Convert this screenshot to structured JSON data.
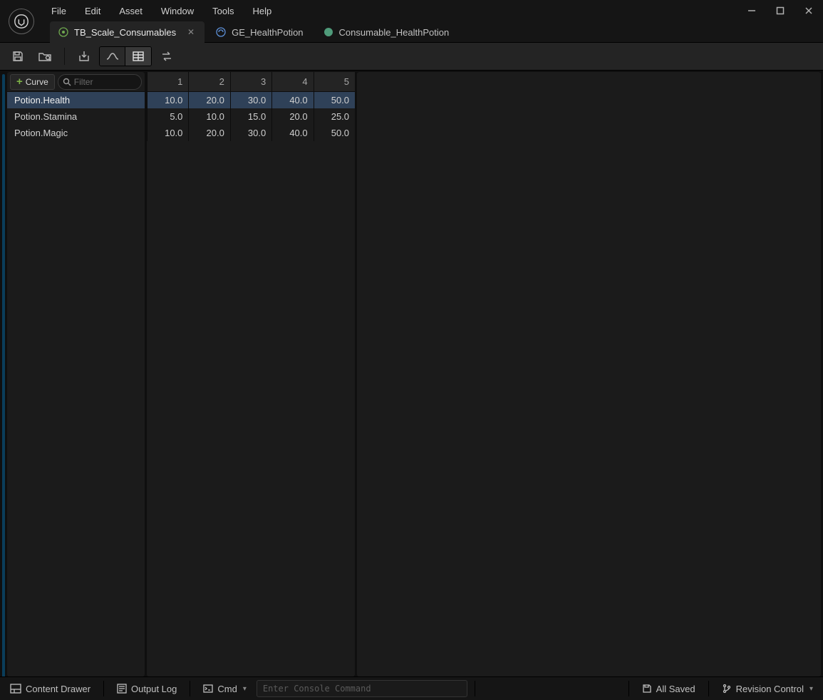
{
  "menu": {
    "file": "File",
    "edit": "Edit",
    "asset": "Asset",
    "window": "Window",
    "tools": "Tools",
    "help": "Help"
  },
  "tabs": [
    {
      "label": "TB_Scale_Consumables",
      "active": true,
      "closable": true,
      "icon": "curve-table"
    },
    {
      "label": "GE_HealthPotion",
      "active": false,
      "closable": false,
      "icon": "gameplay-effect"
    },
    {
      "label": "Consumable_HealthPotion",
      "active": false,
      "closable": false,
      "icon": "data-asset"
    }
  ],
  "curve_panel": {
    "add_label": "Curve",
    "filter_placeholder": "Filter"
  },
  "table": {
    "columns": [
      "1",
      "2",
      "3",
      "4",
      "5"
    ],
    "rows": [
      {
        "name": "Potion.Health",
        "values": [
          "10.0",
          "20.0",
          "30.0",
          "40.0",
          "50.0"
        ],
        "selected": true
      },
      {
        "name": "Potion.Stamina",
        "values": [
          "5.0",
          "10.0",
          "15.0",
          "20.0",
          "25.0"
        ],
        "selected": false
      },
      {
        "name": "Potion.Magic",
        "values": [
          "10.0",
          "20.0",
          "30.0",
          "40.0",
          "50.0"
        ],
        "selected": false
      }
    ]
  },
  "statusbar": {
    "content_drawer": "Content Drawer",
    "output_log": "Output Log",
    "cmd_label": "Cmd",
    "cmd_placeholder": "Enter Console Command",
    "all_saved": "All Saved",
    "revision_control": "Revision Control"
  }
}
